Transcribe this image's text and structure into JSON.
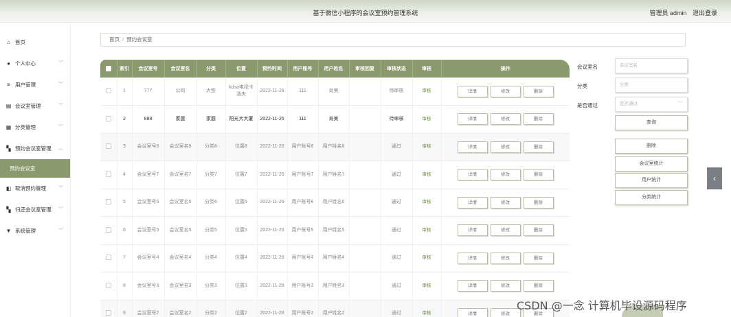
{
  "header": {
    "title": "基于微信小程序的会议室预约管理系统",
    "role": "管理员 admin",
    "logout": "退出登录"
  },
  "sidebar": {
    "items": [
      {
        "label": "首页",
        "icon": "home-icon",
        "glyph": "⌂",
        "chevron": ""
      },
      {
        "label": "个人中心",
        "icon": "user-icon",
        "glyph": "●",
        "chevron": "﹀"
      },
      {
        "label": "用户管理",
        "icon": "list-icon",
        "glyph": "≡",
        "chevron": "﹀"
      },
      {
        "label": "会议室管理",
        "icon": "document-icon",
        "glyph": "▤",
        "chevron": "﹀"
      },
      {
        "label": "分类管理",
        "icon": "folder-icon",
        "glyph": "▦",
        "chevron": "﹀"
      },
      {
        "label": "预约会议室管理",
        "icon": "grid-icon",
        "glyph": "▚",
        "chevron": "︿"
      }
    ],
    "active_sub": "预约会议室",
    "items_after": [
      {
        "label": "取消预约管理",
        "icon": "thumb-icon",
        "glyph": "◧",
        "chevron": "﹀"
      },
      {
        "label": "归还会议室管理",
        "icon": "grid-icon",
        "glyph": "▚",
        "chevron": "﹀"
      },
      {
        "label": "系统管理",
        "icon": "shield-icon",
        "glyph": "▼",
        "chevron": "﹀"
      }
    ]
  },
  "breadcrumb": {
    "home": "首页",
    "sep": "/",
    "current": "预约会议室"
  },
  "table": {
    "headers": [
      "索引",
      "会议室号",
      "会议室名",
      "分类",
      "位置",
      "预约时间",
      "用户账号",
      "用户姓名",
      "审核回复",
      "审核状态",
      "审核",
      "操作"
    ],
    "rows": [
      {
        "idx": "1",
        "room_no": "777",
        "room_name": "公司",
        "category": "大型",
        "location": "kdsa电视卡浩夫",
        "time": "2022-11-28",
        "account": "111",
        "user_name": "肖美",
        "reply": "",
        "status": "待审核",
        "audit": "审核",
        "dark": false
      },
      {
        "idx": "2",
        "room_no": "888",
        "room_name": "家庭",
        "category": "家庭",
        "location": "阳光大大厦",
        "time": "2022-11-26",
        "account": "111",
        "user_name": "肖美",
        "reply": "",
        "status": "待审核",
        "audit": "审核",
        "dark": true
      },
      {
        "idx": "3",
        "room_no": "会议室号8",
        "room_name": "会议室名8",
        "category": "分类8",
        "location": "位置8",
        "time": "2022-11-26",
        "account": "用户账号8",
        "user_name": "用户姓名8",
        "reply": "",
        "status": "通过",
        "audit": "审核",
        "dark": false
      },
      {
        "idx": "4",
        "room_no": "会议室号7",
        "room_name": "会议室名7",
        "category": "分类7",
        "location": "位置7",
        "time": "2022-11-26",
        "account": "用户账号7",
        "user_name": "用户姓名7",
        "reply": "",
        "status": "通过",
        "audit": "审核",
        "dark": false
      },
      {
        "idx": "5",
        "room_no": "会议室号6",
        "room_name": "会议室名6",
        "category": "分类6",
        "location": "位置6",
        "time": "2022-11-26",
        "account": "用户账号6",
        "user_name": "用户姓名6",
        "reply": "",
        "status": "通过",
        "audit": "审核",
        "dark": false
      },
      {
        "idx": "6",
        "room_no": "会议室号5",
        "room_name": "会议室名5",
        "category": "分类5",
        "location": "位置5",
        "time": "2022-11-26",
        "account": "用户账号5",
        "user_name": "用户姓名5",
        "reply": "",
        "status": "通过",
        "audit": "审核",
        "dark": false
      },
      {
        "idx": "7",
        "room_no": "会议室号4",
        "room_name": "会议室名4",
        "category": "分类4",
        "location": "位置4",
        "time": "2022-11-26",
        "account": "用户账号4",
        "user_name": "用户姓名4",
        "reply": "",
        "status": "通过",
        "audit": "审核",
        "dark": false
      },
      {
        "idx": "8",
        "room_no": "会议室号3",
        "room_name": "会议室名3",
        "category": "分类3",
        "location": "位置3",
        "time": "2022-11-26",
        "account": "用户账号3",
        "user_name": "用户姓名3",
        "reply": "",
        "status": "通过",
        "audit": "审核",
        "dark": false
      },
      {
        "idx": "9",
        "room_no": "会议室号2",
        "room_name": "会议室名2",
        "category": "分类2",
        "location": "位置2",
        "time": "2022-11-26",
        "account": "用户账号2",
        "user_name": "用户姓名2",
        "reply": "",
        "status": "通过",
        "audit": "审核",
        "dark": false
      }
    ],
    "actions": [
      "详情",
      "修改",
      "删除"
    ]
  },
  "search": {
    "room_name_label": "会议室名",
    "room_name_placeholder": "会议室名",
    "category_label": "分类",
    "category_placeholder": "分类",
    "approved_label": "是否通过",
    "approved_placeholder": "是否通过",
    "query_button": "查询"
  },
  "side_buttons": {
    "delete": "删除",
    "room_stats": "会议室统计",
    "user_stats": "用户统计",
    "category_stats": "分类统计"
  },
  "watermark": "CSDN @一念 计算机毕设源码程序",
  "colors": {
    "accent": "#8a9a6c",
    "audit_link": "#6a8a3a"
  }
}
